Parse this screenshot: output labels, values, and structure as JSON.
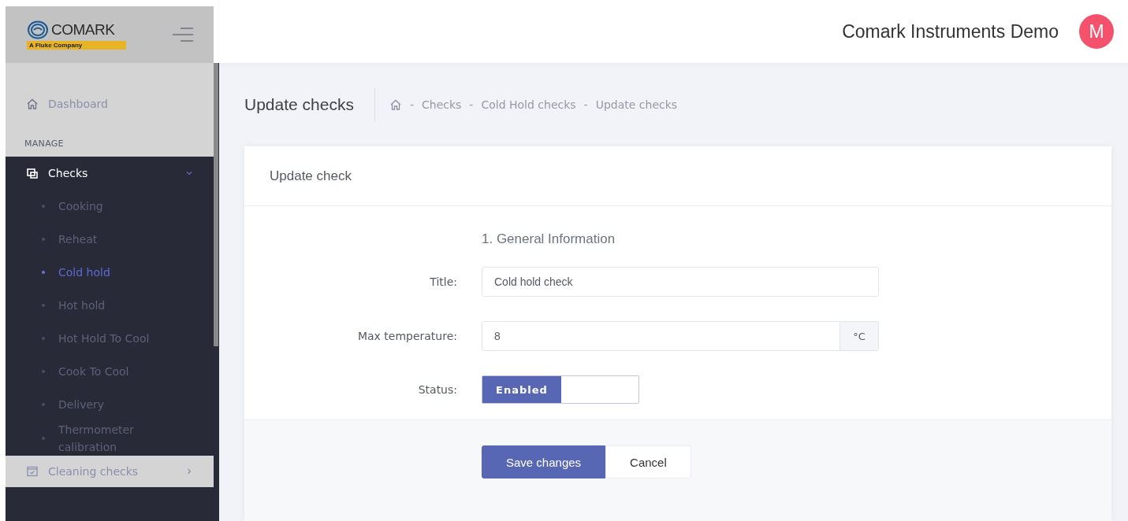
{
  "brand": {
    "name": "COMARK",
    "tagline": "A Fluke Company"
  },
  "header": {
    "user_name": "Comark Instruments Demo",
    "avatar_initial": "M"
  },
  "sidebar": {
    "top_items": [
      {
        "label": "Dashboard",
        "selected": false
      }
    ],
    "section_label": "MANAGE",
    "groups": [
      {
        "label": "Checks",
        "kind": "checks",
        "expanded": true,
        "children": [
          {
            "label": "Cooking",
            "selected": false
          },
          {
            "label": "Reheat",
            "selected": false
          },
          {
            "label": "Cold hold",
            "selected": true
          },
          {
            "label": "Hot hold",
            "selected": false
          },
          {
            "label": "Hot Hold To Cool",
            "selected": false
          },
          {
            "label": "Cook To Cool",
            "selected": false
          },
          {
            "label": "Delivery",
            "selected": false
          },
          {
            "label": "Thermometer calibration",
            "selected": false
          }
        ]
      },
      {
        "label": "Cleaning checks",
        "kind": "cleaning",
        "expanded": false
      }
    ]
  },
  "page": {
    "title": "Update checks",
    "breadcrumb": [
      {
        "separator": "-",
        "label": "Checks"
      },
      {
        "separator": "-",
        "label": "Cold Hold checks"
      },
      {
        "separator": "-",
        "label": "Update checks"
      }
    ]
  },
  "card": {
    "title": "Update check",
    "section_title": "1. General Information",
    "fields": [
      {
        "label": "Title:",
        "kind": "text",
        "value": "Cold hold check"
      },
      {
        "label": "Max temperature:",
        "kind": "unit",
        "value": "8",
        "unit": "°C"
      },
      {
        "label": "Status:",
        "kind": "toggle",
        "value": "Enabled",
        "on": true
      }
    ],
    "buttons": [
      {
        "label": "Save changes",
        "kind": "primary"
      },
      {
        "label": "Cancel",
        "kind": "secondary"
      }
    ]
  }
}
